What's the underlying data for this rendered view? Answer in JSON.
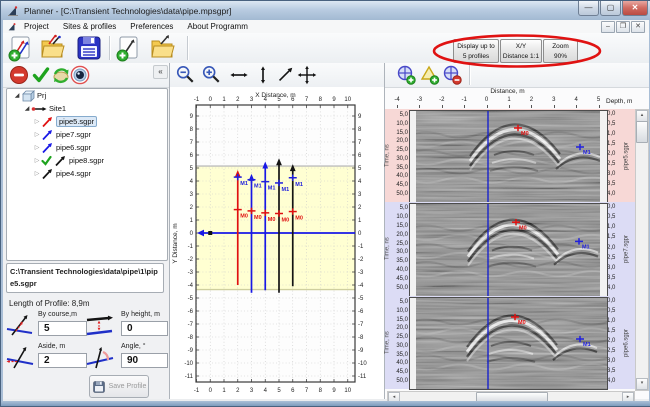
{
  "window": {
    "title": "Planner - [C:\\Transient Technologies\\data\\pipe.mpsgpr]"
  },
  "menu": {
    "items": [
      "Project",
      "Sites & profiles",
      "Preferences",
      "About Programm"
    ]
  },
  "toolbar": {
    "profiles_button": [
      "Display up to",
      "5 profiles"
    ],
    "xy_button": [
      "X/Y",
      "Distance 1:1"
    ],
    "zoom_button": [
      "Zoom",
      "90%"
    ]
  },
  "icons": {
    "main_toolbar": [
      "new-project-icon",
      "open-project-icon",
      "save-project-icon",
      "new-profile-icon",
      "open-profile-icon"
    ],
    "left_toolbar": [
      "remove-icon",
      "apply-check-icon",
      "refresh-icon",
      "eye-view-icon"
    ],
    "mid_toolbar": [
      "zoom-out-icon",
      "zoom-in-icon",
      "stretch-horizontal-icon",
      "stretch-vertical-icon",
      "stretch-diagonal-icon",
      "pan-icon"
    ],
    "right_toolbar": [
      "add-marker-icon",
      "add-triangle-icon",
      "remove-marker-icon"
    ]
  },
  "left_panel": {
    "tree": {
      "root": "Prj",
      "site": "Site1",
      "items": [
        {
          "label": "pipe5.sgpr",
          "color": "#e01010",
          "selected": true,
          "checked": false
        },
        {
          "label": "pipe7.sgpr",
          "color": "#1818e6",
          "selected": false,
          "checked": false
        },
        {
          "label": "pipe6.sgpr",
          "color": "#1818e6",
          "selected": false,
          "checked": false
        },
        {
          "label": "pipe8.sgpr",
          "color": "#141414",
          "selected": false,
          "checked": true
        },
        {
          "label": "pipe4.sgpr",
          "color": "#141414",
          "selected": false,
          "checked": false
        }
      ]
    },
    "path": "C:\\Transient Technologies\\data\\pipe\\1\\pipe5.sgpr",
    "length_label": "Length of Profile: 8,9m",
    "fields": [
      {
        "label": "By course,m",
        "value": "5"
      },
      {
        "label": "By height, m",
        "value": "0"
      },
      {
        "label": "Aside, m",
        "value": "2"
      },
      {
        "label": "Angle, °",
        "value": "90"
      }
    ],
    "save_label": "Save Profile"
  },
  "chart_data": {
    "type": "line",
    "title": "",
    "xlabel": "X Distance, m",
    "ylabel": "Y Distance, m",
    "xlim": [
      -1,
      10
    ],
    "ylim": [
      -11.5,
      9.9
    ],
    "x_ticks": [
      -1,
      0,
      1,
      2,
      3,
      4,
      5,
      6,
      7,
      8,
      9,
      10
    ],
    "y_ticks": [
      9,
      8,
      7,
      6,
      5,
      4,
      3,
      2,
      1,
      0,
      -1,
      -2,
      -3,
      -4,
      -5,
      -6,
      -7,
      -8,
      -9,
      -10,
      -11
    ],
    "grid": "dotted",
    "survey_area_band": {
      "y_from": -4.35,
      "y_to": 5.15,
      "color": "#ffffd2"
    },
    "baseline": {
      "y": 0,
      "from_x": -1,
      "to_x": 10,
      "color": "#1818e6",
      "origin_dot_x": 0
    },
    "profiles": [
      {
        "x": 2,
        "color": "#e01010",
        "y_from": -4.0,
        "y_to": 4.85,
        "m1": 4.3,
        "m0": 1.8
      },
      {
        "x": 3,
        "color": "#1818e6",
        "y_from": -4.6,
        "y_to": 4.55,
        "m1": 4.1,
        "m0": 1.7
      },
      {
        "x": 4,
        "color": "#1818e6",
        "y_from": -4.4,
        "y_to": 5.5,
        "m1": 3.95,
        "m0": 1.55
      },
      {
        "x": 5,
        "color": "#141414",
        "y_from": -4.6,
        "y_to": 5.75,
        "m1": 3.85,
        "m0": 1.5
      },
      {
        "x": 6,
        "color": "#141414",
        "y_from": -4.1,
        "y_to": 5.3,
        "m1": 4.25,
        "m0": 1.65
      }
    ],
    "marker_labels": {
      "m0": "M0",
      "m1": "M1"
    }
  },
  "radargrams": {
    "xlabel": "Distance, m",
    "x_ticks": [
      -4,
      -3,
      -2,
      -1,
      0,
      1,
      2,
      3,
      4,
      5
    ],
    "depth_label": "Depth, m",
    "time_label": "Time, ns",
    "time_ticks": [
      "5,0",
      "10,0",
      "15,0",
      "20,0",
      "25,0",
      "30,0",
      "35,0",
      "40,0",
      "45,0",
      "50,0"
    ],
    "depth_ticks": [
      "0,0",
      "0,5",
      "1,0",
      "1,5",
      "2,0",
      "2,5",
      "3,0",
      "3,5",
      "4,0"
    ],
    "marker_labels": {
      "m0": "M0",
      "m1": "M1"
    },
    "rows": [
      {
        "name": "pipe5.sgpr",
        "band": "#f7d8d6",
        "m0": [
          108,
          17
        ],
        "m1": [
          170,
          36
        ]
      },
      {
        "name": "pipe7.sgpr",
        "band": "#dcdcf5",
        "m0": [
          106,
          18
        ],
        "m1": [
          169,
          37
        ]
      },
      {
        "name": "pipe6.sgpr",
        "band": "#dcdcf5",
        "m0": [
          105,
          19
        ],
        "m1": [
          170,
          41
        ]
      }
    ]
  }
}
